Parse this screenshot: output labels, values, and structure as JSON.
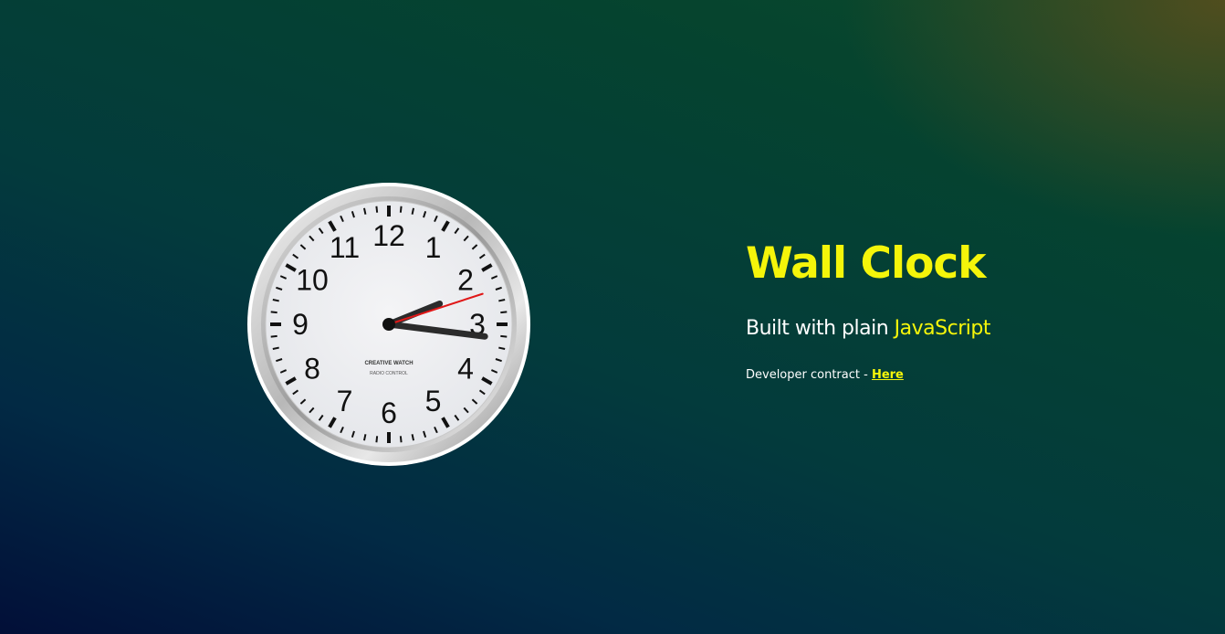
{
  "clock": {
    "brand": "CREATIVE WATCH",
    "model": "RADIO CONTROL",
    "numerals": [
      "12",
      "1",
      "2",
      "3",
      "4",
      "5",
      "6",
      "7",
      "8",
      "9",
      "10",
      "11"
    ],
    "time": {
      "hours": 2,
      "minutes": 16,
      "seconds": 12
    }
  },
  "info": {
    "title": "Wall Clock",
    "subtitle_prefix": "Built with plain",
    "subtitle_highlight": "JavaScript",
    "developer_text": "Developer contract -",
    "developer_link": "Here"
  },
  "colors": {
    "accent": "#f5f50a",
    "second_hand": "#e01818",
    "hands": "#2b2b2b"
  }
}
